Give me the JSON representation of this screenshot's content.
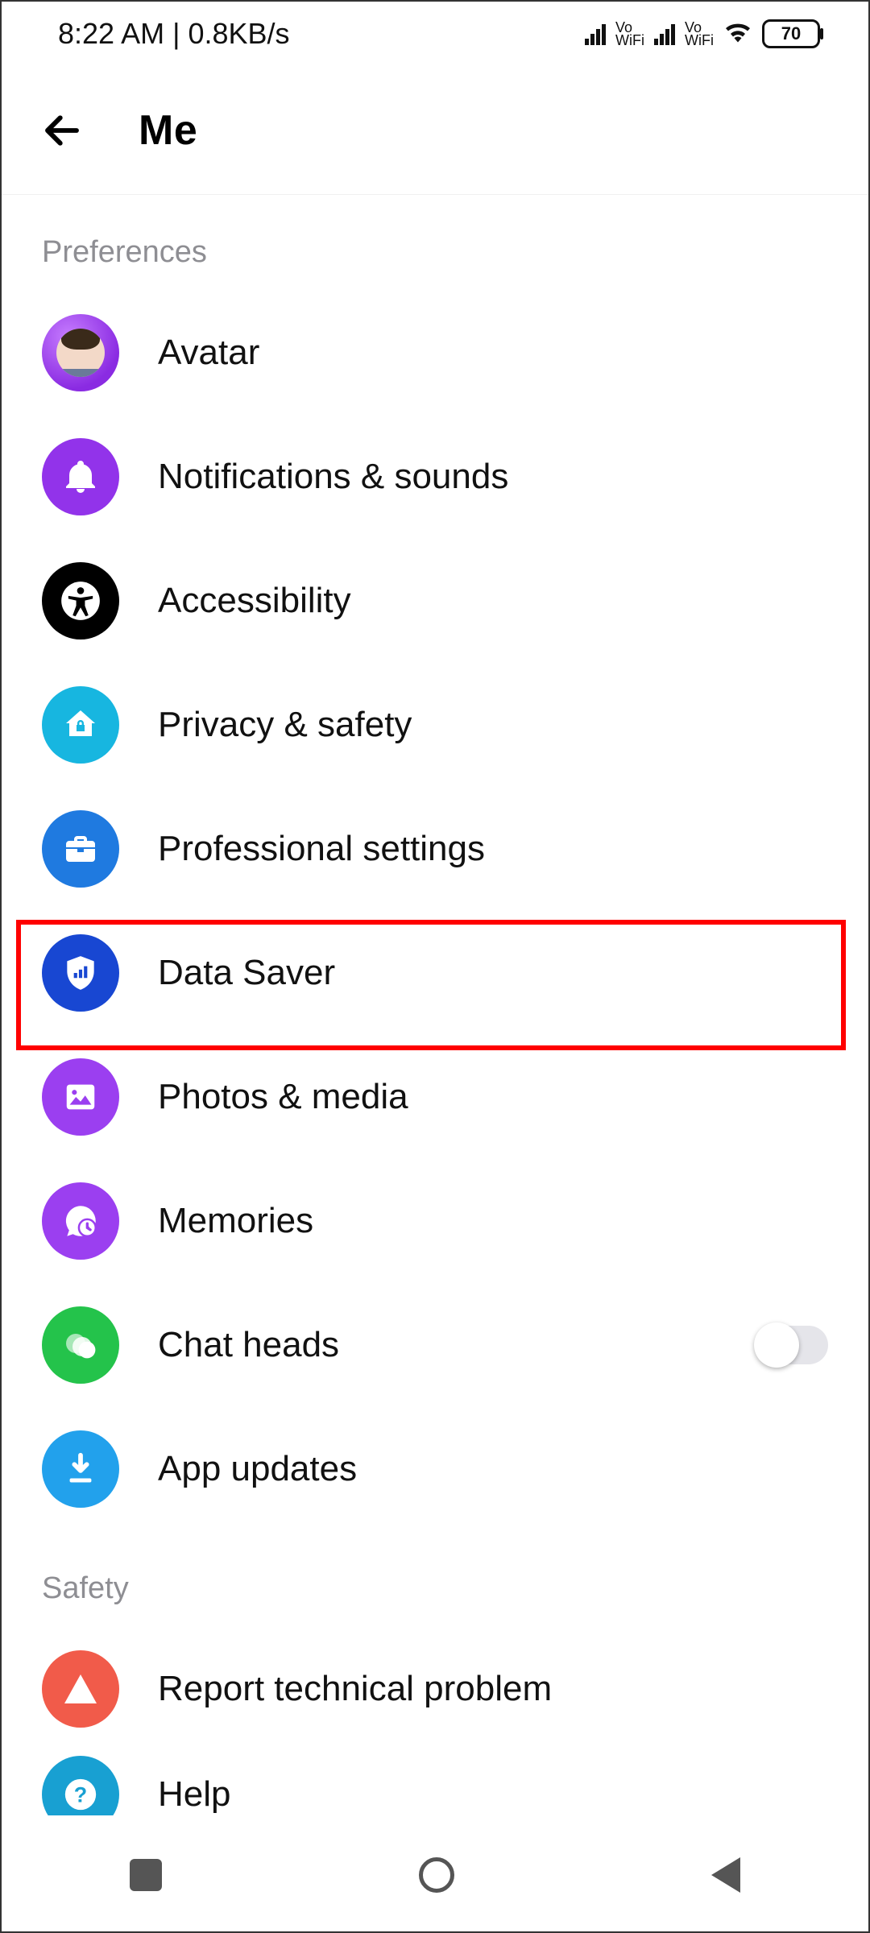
{
  "status": {
    "time": "8:22 AM",
    "net_speed": "0.8KB/s",
    "vo_label": "Vo",
    "wifi_label": "WiFi",
    "battery": "70"
  },
  "header": {
    "title": "Me"
  },
  "sections": {
    "preferences": {
      "title": "Preferences",
      "items": {
        "avatar": "Avatar",
        "notifications": "Notifications & sounds",
        "accessibility": "Accessibility",
        "privacy": "Privacy & safety",
        "professional": "Professional settings",
        "data_saver": "Data Saver",
        "photos": "Photos & media",
        "memories": "Memories",
        "chat_heads": "Chat heads",
        "app_updates": "App updates"
      },
      "chat_heads_toggle_on": false
    },
    "safety": {
      "title": "Safety",
      "items": {
        "report": "Report technical problem",
        "help": "Help"
      }
    }
  },
  "highlight": {
    "item_key": "data_saver"
  }
}
